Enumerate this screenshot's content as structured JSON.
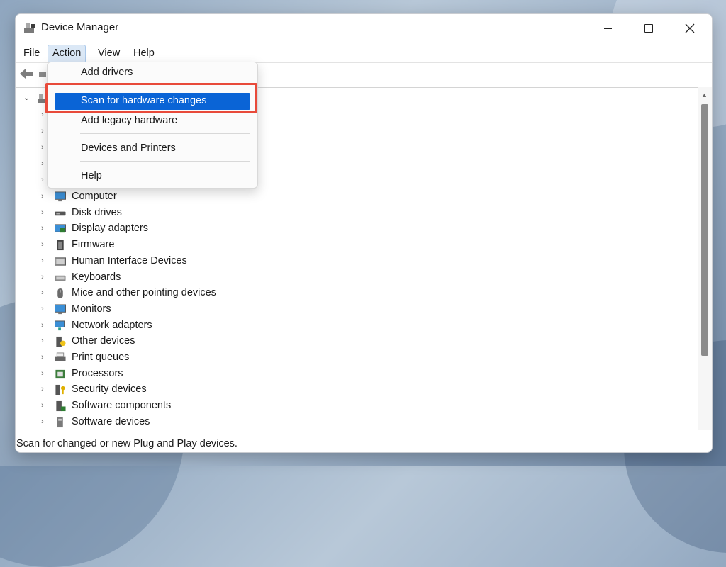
{
  "window": {
    "title": "Device Manager"
  },
  "menubar": {
    "items": [
      "File",
      "Action",
      "View",
      "Help"
    ]
  },
  "action_menu": {
    "items": [
      {
        "label": "Add drivers",
        "highlighted": false
      },
      {
        "label": "Scan for hardware changes",
        "highlighted": true
      },
      {
        "label": "Add legacy hardware",
        "highlighted": false
      },
      {
        "label": "Devices and Printers",
        "highlighted": false
      },
      {
        "label": "Help",
        "highlighted": false
      }
    ],
    "highlight_color": "#0a64d6",
    "annotation_color": "#e84a3a"
  },
  "tree": {
    "categories": [
      {
        "label": "Computer",
        "icon": "monitor-icon"
      },
      {
        "label": "Disk drives",
        "icon": "disk-drive-icon"
      },
      {
        "label": "Display adapters",
        "icon": "display-adapter-icon"
      },
      {
        "label": "Firmware",
        "icon": "firmware-icon"
      },
      {
        "label": "Human Interface Devices",
        "icon": "hid-icon"
      },
      {
        "label": "Keyboards",
        "icon": "keyboard-icon"
      },
      {
        "label": "Mice and other pointing devices",
        "icon": "mouse-icon"
      },
      {
        "label": "Monitors",
        "icon": "monitor-icon"
      },
      {
        "label": "Network adapters",
        "icon": "network-adapter-icon"
      },
      {
        "label": "Other devices",
        "icon": "other-device-icon"
      },
      {
        "label": "Print queues",
        "icon": "printer-icon"
      },
      {
        "label": "Processors",
        "icon": "processor-icon"
      },
      {
        "label": "Security devices",
        "icon": "security-device-icon"
      },
      {
        "label": "Software components",
        "icon": "software-component-icon"
      },
      {
        "label": "Software devices",
        "icon": "software-device-icon"
      }
    ]
  },
  "status": {
    "text": "Scan for changed or new Plug and Play devices."
  }
}
